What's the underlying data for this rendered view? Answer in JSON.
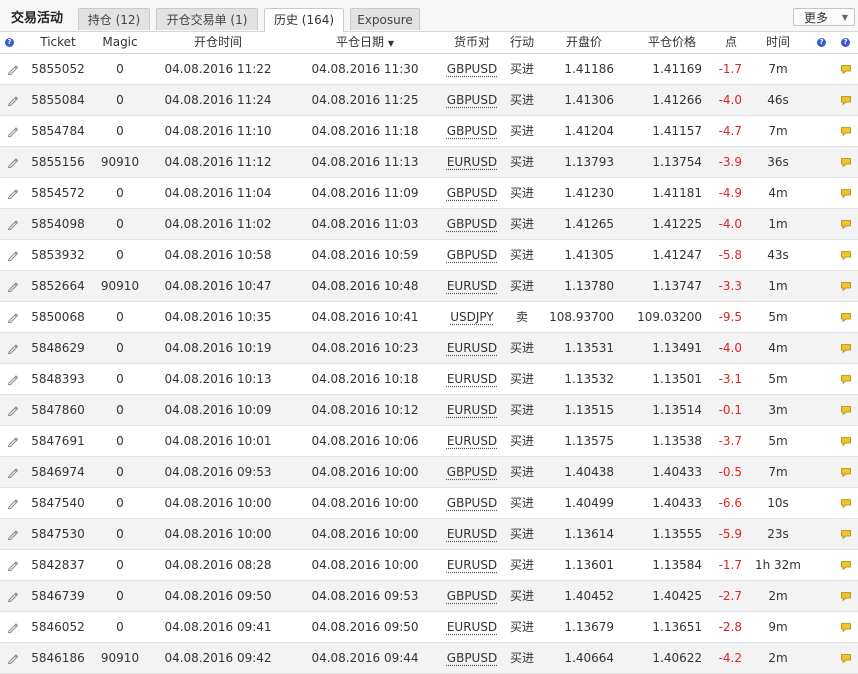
{
  "panel": {
    "title": "交易活动",
    "tabs": [
      {
        "label": "持仓 (12)"
      },
      {
        "label": "开仓交易单 (1)"
      },
      {
        "label": "历史 (164)"
      },
      {
        "label": "Exposure"
      }
    ],
    "active_tab": "历史 (164)",
    "more_label": "更多"
  },
  "columns": {
    "help1": "?",
    "ticket": "Ticket",
    "magic": "Magic",
    "open_time": "开仓时间",
    "close_date": "平仓日期",
    "symbol": "货币对",
    "action": "行动",
    "open_price": "开盘价",
    "close_price": "平仓价格",
    "points": "点",
    "duration": "时间",
    "help2": "?",
    "help3": "?"
  },
  "colors": {
    "negative": "#e02424",
    "help_icon": "#3a5bd0",
    "note_icon": "#f2c22b"
  },
  "rows": [
    {
      "ticket": "5855052",
      "magic": "0",
      "open": "04.08.2016 11:22",
      "close": "04.08.2016 11:30",
      "symbol": "GBPUSD",
      "action": "买进",
      "open_price": "1.41186",
      "close_price": "1.41169",
      "points": "-1.7",
      "duration": "7m"
    },
    {
      "ticket": "5855084",
      "magic": "0",
      "open": "04.08.2016 11:24",
      "close": "04.08.2016 11:25",
      "symbol": "GBPUSD",
      "action": "买进",
      "open_price": "1.41306",
      "close_price": "1.41266",
      "points": "-4.0",
      "duration": "46s"
    },
    {
      "ticket": "5854784",
      "magic": "0",
      "open": "04.08.2016 11:10",
      "close": "04.08.2016 11:18",
      "symbol": "GBPUSD",
      "action": "买进",
      "open_price": "1.41204",
      "close_price": "1.41157",
      "points": "-4.7",
      "duration": "7m"
    },
    {
      "ticket": "5855156",
      "magic": "90910",
      "open": "04.08.2016 11:12",
      "close": "04.08.2016 11:13",
      "symbol": "EURUSD",
      "action": "买进",
      "open_price": "1.13793",
      "close_price": "1.13754",
      "points": "-3.9",
      "duration": "36s"
    },
    {
      "ticket": "5854572",
      "magic": "0",
      "open": "04.08.2016 11:04",
      "close": "04.08.2016 11:09",
      "symbol": "GBPUSD",
      "action": "买进",
      "open_price": "1.41230",
      "close_price": "1.41181",
      "points": "-4.9",
      "duration": "4m"
    },
    {
      "ticket": "5854098",
      "magic": "0",
      "open": "04.08.2016 11:02",
      "close": "04.08.2016 11:03",
      "symbol": "GBPUSD",
      "action": "买进",
      "open_price": "1.41265",
      "close_price": "1.41225",
      "points": "-4.0",
      "duration": "1m"
    },
    {
      "ticket": "5853932",
      "magic": "0",
      "open": "04.08.2016 10:58",
      "close": "04.08.2016 10:59",
      "symbol": "GBPUSD",
      "action": "买进",
      "open_price": "1.41305",
      "close_price": "1.41247",
      "points": "-5.8",
      "duration": "43s"
    },
    {
      "ticket": "5852664",
      "magic": "90910",
      "open": "04.08.2016 10:47",
      "close": "04.08.2016 10:48",
      "symbol": "EURUSD",
      "action": "买进",
      "open_price": "1.13780",
      "close_price": "1.13747",
      "points": "-3.3",
      "duration": "1m"
    },
    {
      "ticket": "5850068",
      "magic": "0",
      "open": "04.08.2016 10:35",
      "close": "04.08.2016 10:41",
      "symbol": "USDJPY",
      "action": "卖",
      "open_price": "108.93700",
      "close_price": "109.03200",
      "points": "-9.5",
      "duration": "5m"
    },
    {
      "ticket": "5848629",
      "magic": "0",
      "open": "04.08.2016 10:19",
      "close": "04.08.2016 10:23",
      "symbol": "EURUSD",
      "action": "买进",
      "open_price": "1.13531",
      "close_price": "1.13491",
      "points": "-4.0",
      "duration": "4m"
    },
    {
      "ticket": "5848393",
      "magic": "0",
      "open": "04.08.2016 10:13",
      "close": "04.08.2016 10:18",
      "symbol": "EURUSD",
      "action": "买进",
      "open_price": "1.13532",
      "close_price": "1.13501",
      "points": "-3.1",
      "duration": "5m"
    },
    {
      "ticket": "5847860",
      "magic": "0",
      "open": "04.08.2016 10:09",
      "close": "04.08.2016 10:12",
      "symbol": "EURUSD",
      "action": "买进",
      "open_price": "1.13515",
      "close_price": "1.13514",
      "points": "-0.1",
      "duration": "3m"
    },
    {
      "ticket": "5847691",
      "magic": "0",
      "open": "04.08.2016 10:01",
      "close": "04.08.2016 10:06",
      "symbol": "EURUSD",
      "action": "买进",
      "open_price": "1.13575",
      "close_price": "1.13538",
      "points": "-3.7",
      "duration": "5m"
    },
    {
      "ticket": "5846974",
      "magic": "0",
      "open": "04.08.2016 09:53",
      "close": "04.08.2016 10:00",
      "symbol": "GBPUSD",
      "action": "买进",
      "open_price": "1.40438",
      "close_price": "1.40433",
      "points": "-0.5",
      "duration": "7m"
    },
    {
      "ticket": "5847540",
      "magic": "0",
      "open": "04.08.2016 10:00",
      "close": "04.08.2016 10:00",
      "symbol": "GBPUSD",
      "action": "买进",
      "open_price": "1.40499",
      "close_price": "1.40433",
      "points": "-6.6",
      "duration": "10s"
    },
    {
      "ticket": "5847530",
      "magic": "0",
      "open": "04.08.2016 10:00",
      "close": "04.08.2016 10:00",
      "symbol": "EURUSD",
      "action": "买进",
      "open_price": "1.13614",
      "close_price": "1.13555",
      "points": "-5.9",
      "duration": "23s"
    },
    {
      "ticket": "5842837",
      "magic": "0",
      "open": "04.08.2016 08:28",
      "close": "04.08.2016 10:00",
      "symbol": "EURUSD",
      "action": "买进",
      "open_price": "1.13601",
      "close_price": "1.13584",
      "points": "-1.7",
      "duration": "1h 32m"
    },
    {
      "ticket": "5846739",
      "magic": "0",
      "open": "04.08.2016 09:50",
      "close": "04.08.2016 09:53",
      "symbol": "GBPUSD",
      "action": "买进",
      "open_price": "1.40452",
      "close_price": "1.40425",
      "points": "-2.7",
      "duration": "2m"
    },
    {
      "ticket": "5846052",
      "magic": "0",
      "open": "04.08.2016 09:41",
      "close": "04.08.2016 09:50",
      "symbol": "EURUSD",
      "action": "买进",
      "open_price": "1.13679",
      "close_price": "1.13651",
      "points": "-2.8",
      "duration": "9m"
    },
    {
      "ticket": "5846186",
      "magic": "90910",
      "open": "04.08.2016 09:42",
      "close": "04.08.2016 09:44",
      "symbol": "GBPUSD",
      "action": "买进",
      "open_price": "1.40664",
      "close_price": "1.40622",
      "points": "-4.2",
      "duration": "2m"
    }
  ]
}
